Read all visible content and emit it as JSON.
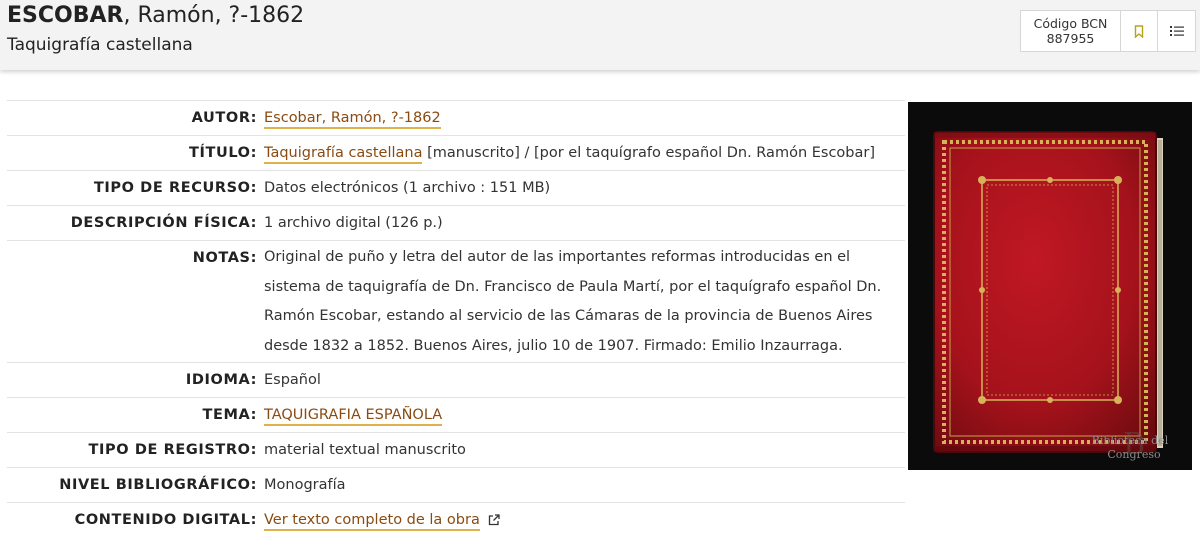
{
  "header": {
    "surname": "ESCOBAR",
    "name_rest": ", Ramón, ?-1862",
    "subtitle": "Taquigrafía castellana",
    "bcn_label": "Código BCN",
    "bcn_code": "887955",
    "bookmark_icon": "bookmark-icon",
    "list_icon": "list-icon"
  },
  "record": {
    "autor": {
      "label": "AUTOR:",
      "value": "Escobar, Ramón, ?-1862"
    },
    "titulo": {
      "label": "TÍTULO:",
      "link": "Taquigrafía castellana",
      "rest": " [manuscrito] / [por el taquígrafo español Dn. Ramón Escobar]"
    },
    "tipo_recurso": {
      "label": "TIPO DE RECURSO:",
      "value": "Datos electrónicos (1 archivo : 151 MB)"
    },
    "descripcion": {
      "label": "DESCRIPCIÓN FÍSICA:",
      "value": "1 archivo digital (126 p.)"
    },
    "notas": {
      "label": "NOTAS:",
      "value": "Original de puño y letra del autor de las importantes reformas introducidas en el sistema de taquigrafía de Dn. Francisco de Paula Martí, por el taquígrafo español Dn. Ramón Escobar, estando al servicio de las Cámaras de la provincia de Buenos Aires desde 1832 a 1852. Buenos Aires, julio 10 de 1907. Firmado: Emilio Inzaurraga."
    },
    "idioma": {
      "label": "IDIOMA:",
      "value": "Español"
    },
    "tema": {
      "label": "TEMA:",
      "value": "TAQUIGRAFIA ESPAÑOLA"
    },
    "tipo_registro": {
      "label": "TIPO DE REGISTRO:",
      "value": "material textual manuscrito"
    },
    "nivel": {
      "label": "NIVEL BIBLIOGRÁFICO:",
      "value": "Monografía"
    },
    "contenido": {
      "label": "CONTENIDO DIGITAL:",
      "value": "Ver texto completo de la obra",
      "icon": "external-link-icon"
    }
  },
  "cover": {
    "watermark_line1": "Biblioteca del",
    "watermark_line2": "Congreso",
    "cover_color": "#a8121c",
    "gold_color": "#d8b25a"
  }
}
